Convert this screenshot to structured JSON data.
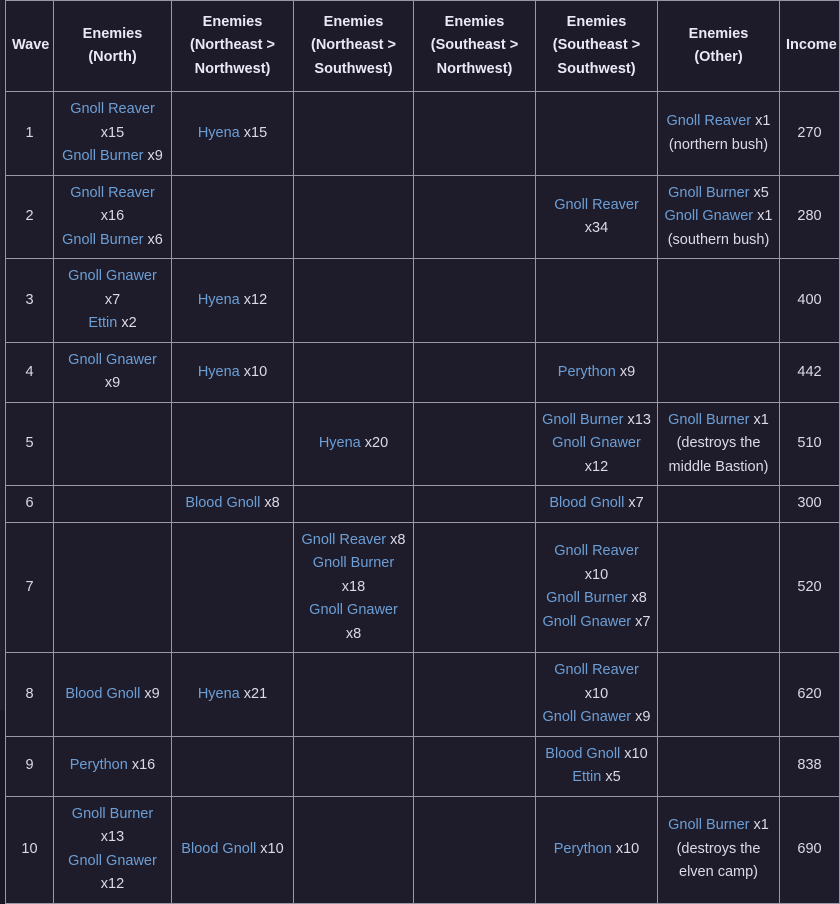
{
  "table": {
    "headers": [
      {
        "lines": [
          "Wave"
        ]
      },
      {
        "lines": [
          "Enemies",
          "(North)"
        ]
      },
      {
        "lines": [
          "Enemies",
          "(Northeast >",
          "Northwest)"
        ]
      },
      {
        "lines": [
          "Enemies",
          "(Northeast >",
          "Southwest)"
        ]
      },
      {
        "lines": [
          "Enemies",
          "(Southeast >",
          "Northwest)"
        ]
      },
      {
        "lines": [
          "Enemies",
          "(Southeast >",
          "Southwest)"
        ]
      },
      {
        "lines": [
          "Enemies",
          "(Other)"
        ]
      },
      {
        "lines": [
          "Income"
        ]
      }
    ],
    "rows": [
      {
        "wave": "1",
        "north": [
          {
            "name": "Gnoll Reaver",
            "count": "x15"
          },
          {
            "name": "Gnoll Burner",
            "count": "x9"
          }
        ],
        "ne_nw": [
          {
            "name": "Hyena",
            "count": "x15"
          }
        ],
        "ne_sw": [],
        "se_nw": [],
        "se_sw": [],
        "other": [
          {
            "name": "Gnoll Reaver",
            "count": "x1"
          },
          {
            "note": "(northern bush)"
          }
        ],
        "income": "270"
      },
      {
        "wave": "2",
        "north": [
          {
            "name": "Gnoll Reaver",
            "count": "x16"
          },
          {
            "name": "Gnoll Burner",
            "count": "x6"
          }
        ],
        "ne_nw": [],
        "ne_sw": [],
        "se_nw": [],
        "se_sw": [
          {
            "name": "Gnoll Reaver",
            "count": "x34"
          }
        ],
        "other": [
          {
            "name": "Gnoll Burner",
            "count": "x5"
          },
          {
            "name": "Gnoll Gnawer",
            "count": "x1"
          },
          {
            "note": "(southern bush)"
          }
        ],
        "income": "280"
      },
      {
        "wave": "3",
        "north": [
          {
            "name": "Gnoll Gnawer",
            "count": "x7"
          },
          {
            "name": "Ettin",
            "count": "x2"
          }
        ],
        "ne_nw": [
          {
            "name": "Hyena",
            "count": "x12"
          }
        ],
        "ne_sw": [],
        "se_nw": [],
        "se_sw": [],
        "other": [],
        "income": "400"
      },
      {
        "wave": "4",
        "north": [
          {
            "name": "Gnoll Gnawer",
            "count": "x9"
          }
        ],
        "ne_nw": [
          {
            "name": "Hyena",
            "count": "x10"
          }
        ],
        "ne_sw": [],
        "se_nw": [],
        "se_sw": [
          {
            "name": "Perython",
            "count": "x9"
          }
        ],
        "other": [],
        "income": "442"
      },
      {
        "wave": "5",
        "north": [],
        "ne_nw": [],
        "ne_sw": [
          {
            "name": "Hyena",
            "count": "x20"
          }
        ],
        "se_nw": [],
        "se_sw": [
          {
            "name": "Gnoll Burner",
            "count": "x13"
          },
          {
            "name": "Gnoll Gnawer",
            "count": "x12"
          }
        ],
        "other": [
          {
            "name": "Gnoll Burner",
            "count": "x1"
          },
          {
            "note": "(destroys the middle Bastion)"
          }
        ],
        "income": "510"
      },
      {
        "wave": "6",
        "north": [],
        "ne_nw": [
          {
            "name": "Blood Gnoll",
            "count": "x8"
          }
        ],
        "ne_sw": [],
        "se_nw": [],
        "se_sw": [
          {
            "name": "Blood Gnoll",
            "count": "x7"
          }
        ],
        "other": [],
        "income": "300"
      },
      {
        "wave": "7",
        "north": [],
        "ne_nw": [],
        "ne_sw": [
          {
            "name": "Gnoll Reaver",
            "count": "x8"
          },
          {
            "name": "Gnoll Burner",
            "count": "x18"
          },
          {
            "name": "Gnoll Gnawer",
            "count": "x8"
          }
        ],
        "se_nw": [],
        "se_sw": [
          {
            "name": "Gnoll Reaver",
            "count": "x10"
          },
          {
            "name": "Gnoll Burner",
            "count": "x8"
          },
          {
            "name": "Gnoll Gnawer",
            "count": "x7"
          }
        ],
        "other": [],
        "income": "520"
      },
      {
        "wave": "8",
        "north": [
          {
            "name": "Blood Gnoll",
            "count": "x9"
          }
        ],
        "ne_nw": [
          {
            "name": "Hyena",
            "count": "x21"
          }
        ],
        "ne_sw": [],
        "se_nw": [],
        "se_sw": [
          {
            "name": "Gnoll Reaver",
            "count": "x10"
          },
          {
            "name": "Gnoll Gnawer",
            "count": "x9"
          }
        ],
        "other": [],
        "income": "620"
      },
      {
        "wave": "9",
        "north": [
          {
            "name": "Perython",
            "count": "x16"
          }
        ],
        "ne_nw": [],
        "ne_sw": [],
        "se_nw": [],
        "se_sw": [
          {
            "name": "Blood Gnoll",
            "count": "x10"
          },
          {
            "name": "Ettin",
            "count": "x5"
          }
        ],
        "other": [],
        "income": "838"
      },
      {
        "wave": "10",
        "north": [
          {
            "name": "Gnoll Burner",
            "count": "x13"
          },
          {
            "name": "Gnoll Gnawer",
            "count": "x12"
          }
        ],
        "ne_nw": [
          {
            "name": "Blood Gnoll",
            "count": "x10"
          }
        ],
        "ne_sw": [],
        "se_nw": [],
        "se_sw": [
          {
            "name": "Perython",
            "count": "x10"
          }
        ],
        "other": [
          {
            "name": "Gnoll Burner",
            "count": "x1"
          },
          {
            "note": "(destroys the elven camp)"
          }
        ],
        "income": "690"
      }
    ]
  },
  "colors": {
    "link": "#6c9fd6",
    "text": "#dcd9e8",
    "header_text": "#ebe8f5",
    "border": "#9a98a8",
    "cell_bg": "#1e1b2a",
    "page_bg": "#1b1825"
  }
}
